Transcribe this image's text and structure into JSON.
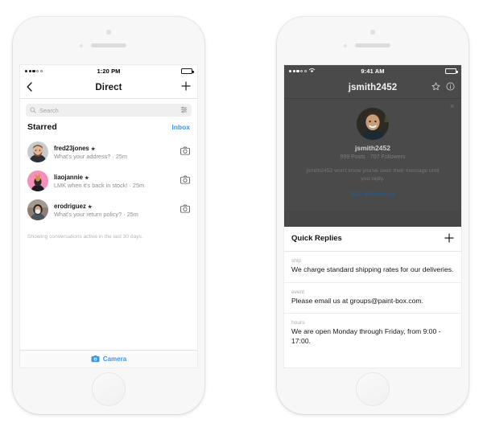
{
  "left_phone": {
    "status_bar": {
      "time": "1:20 PM",
      "signal_filled": 3,
      "signal_empty": 2,
      "battery_level": 72
    },
    "nav": {
      "back_icon": "chevron-left-icon",
      "title": "Direct",
      "add_icon": "plus-icon"
    },
    "search": {
      "placeholder": "Search",
      "icon": "search-icon",
      "filter_icon": "sliders-icon"
    },
    "section": {
      "title": "Starred",
      "action_label": "Inbox",
      "action_color": "#3897f0"
    },
    "conversations": [
      {
        "username": "fred23jones",
        "starred": true,
        "preview": "What's your address? · 25m",
        "action_icon": "camera-icon",
        "avatar": "bearded-man-photo"
      },
      {
        "username": "liaojannie",
        "starred": true,
        "preview": "LMK when it's back in stock! · 25m",
        "action_icon": "camera-icon",
        "avatar": "pink-background-photo"
      },
      {
        "username": "erodriguez",
        "starred": true,
        "preview": "What's your return policy? · 25m",
        "action_icon": "camera-icon",
        "avatar": "woman-photo"
      }
    ],
    "footnote": "Showing conversations active in the last 30 days.",
    "bottom_bar": {
      "label": "Camera",
      "icon": "camera-icon",
      "color": "#3897f0"
    }
  },
  "right_phone": {
    "status_bar": {
      "time": "9:41 AM",
      "wifi_icon": "wifi-icon",
      "signal_filled": 3,
      "signal_empty": 2,
      "battery_level": 100
    },
    "nav": {
      "title": "jsmith2452",
      "star_icon": "star-outline-icon",
      "info_icon": "info-circle-icon"
    },
    "profile_card": {
      "close_icon": "close-icon",
      "avatar": "smiling-man-photo",
      "username": "jsmith2452",
      "stats": "999 Posts · 707 Followers",
      "note": "jsmith2452 won't know you've seen their message until you reply.",
      "action_label": "Not interested",
      "action_color": "#2b5a86"
    },
    "quick_replies": {
      "title": "Quick Replies",
      "add_icon": "plus-icon",
      "items": [
        {
          "shortcut": "ship",
          "text": "We charge standard shipping rates for our deliveries."
        },
        {
          "shortcut": "event",
          "text": "Please email us at groups@paint-box.com."
        },
        {
          "shortcut": "hours",
          "text": "We are open Monday through Friday, from 9:00 - 17:00."
        }
      ]
    }
  }
}
